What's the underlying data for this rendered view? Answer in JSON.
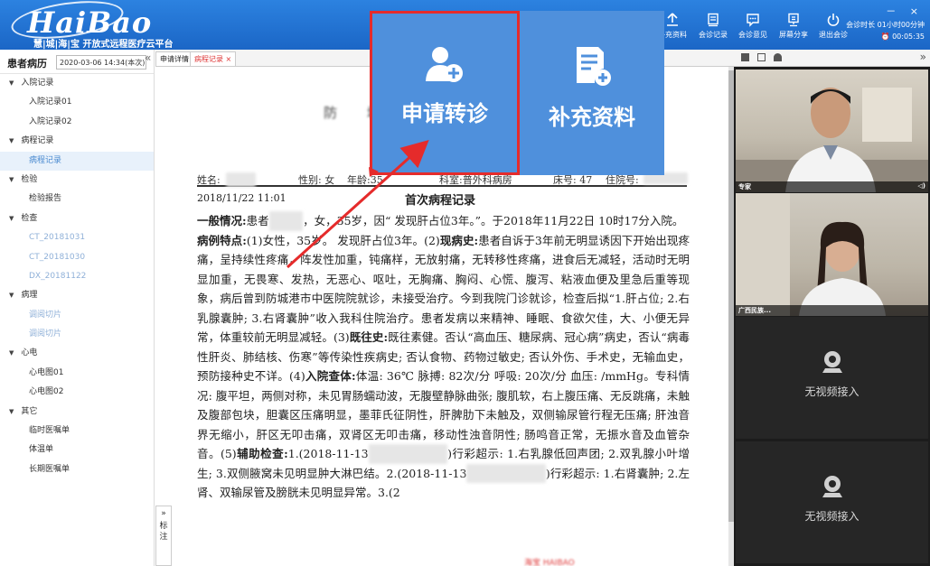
{
  "app": {
    "logo": "HaiBao",
    "tagline": "慧|城|海|宝 开放式远程医疗云平台",
    "window_controls": "－ ×"
  },
  "toolbar": {
    "buttons": [
      {
        "icon": "upload-icon",
        "label": "补充资料"
      },
      {
        "icon": "record-icon",
        "label": "会诊记录"
      },
      {
        "icon": "chat-icon",
        "label": "会诊意见"
      },
      {
        "icon": "screen-share-icon",
        "label": "屏幕分享"
      },
      {
        "icon": "power-icon",
        "label": "退出会诊"
      }
    ],
    "session_label": "会诊时长 01小时00分钟",
    "session_clock": "⏰ 00:05:35"
  },
  "sidebar": {
    "title": "患者病历",
    "date_select": "2020-03-06 14:34(本次) ▾",
    "collapse": "«",
    "groups": [
      {
        "label": "入院记录",
        "items": [
          {
            "label": "入院记录01"
          },
          {
            "label": "入院记录02"
          }
        ]
      },
      {
        "label": "病程记录",
        "items": [
          {
            "label": "病程记录",
            "active": true
          }
        ]
      },
      {
        "label": "检验",
        "items": [
          {
            "label": "检验报告"
          }
        ]
      },
      {
        "label": "检查",
        "items": [
          {
            "label": "CT_20181031",
            "dim": true
          },
          {
            "label": "CT_20181030",
            "dim": true
          },
          {
            "label": "DX_20181122",
            "dim": true
          }
        ]
      },
      {
        "label": "病理",
        "items": [
          {
            "label": "调阅切片",
            "dim": true
          },
          {
            "label": "调阅切片",
            "dim": true
          }
        ]
      },
      {
        "label": "心电",
        "items": [
          {
            "label": "心电图01"
          },
          {
            "label": "心电图02"
          }
        ]
      },
      {
        "label": "其它",
        "items": [
          {
            "label": "临时医嘱单"
          },
          {
            "label": "体温单"
          },
          {
            "label": "长期医嘱单"
          }
        ]
      }
    ]
  },
  "tabs": [
    {
      "label": "申请详情"
    },
    {
      "label": "病程记录 ×",
      "active": true
    }
  ],
  "document": {
    "hospital": "防 城",
    "patient_row": {
      "name_label": "姓名:",
      "gender": "性别: 女",
      "age": "年龄:35",
      "dept": "科室:普外科病房",
      "bed": "床号: 47",
      "admission_label": "住院号:"
    },
    "date": "2018/11/22 11:01",
    "title": "首次病程记录",
    "paragraphs": [
      [
        {
          "b": "一般情况:"
        },
        {
          "t": "患者"
        },
        {
          "blur": "某某某"
        },
        {
          "t": "，女，35岁，因“ 发现肝占位3年。”。于2018年11月22日 10时17分入院。"
        }
      ],
      [
        {
          "b": "病例特点:"
        },
        {
          "t": "(1)女性，35岁。 发现肝占位3年。(2)"
        },
        {
          "b": "现病史:"
        },
        {
          "t": "患者自诉于3年前无明显诱因下开始出现疼痛，呈持续性疼痛，阵发性加重，钝痛样，无放射痛，无转移性疼痛，进食后无减轻，活动时无明显加重，无畏寒、发热，无恶心、呕吐，无胸痛、胸闷、心慌、腹泻、粘液血便及里急后重等现象，病后曾到防城港市中医院院就诊，未接受治疗。今到我院门诊就诊，检查后拟“1.肝占位; 2.右乳腺囊肿; 3.右肾囊肿”收入我科住院治疗。患者发病以来精神、睡眠、食欲欠佳，大、小便无异常，体重较前无明显减轻。(3)"
        },
        {
          "b": "既往史:"
        },
        {
          "t": "既往素健。否认“高血压、糖尿病、冠心病”病史，否认“病毒性肝炎、肺结核、伤寒”等传染性疾病史; 否认食物、药物过敏史; 否认外伤、手术史，无输血史，预防接种史不详。(4)"
        },
        {
          "b": "入院查体:"
        },
        {
          "t": "体温: 36℃ 脉搏: 82次/分 呼吸: 20次/分 血压: /mmHg。专科情况: 腹平坦，两侧对称，未见胃肠蠕动波，无腹壁静脉曲张; 腹肌软，右上腹压痛、无反跳痛，未触及腹部包块，胆囊区压痛明显，墨菲氏征阴性，肝脾肋下未触及，双侧输尿管行程无压痛; 肝浊音界无缩小，肝区无叩击痛，双肾区无叩击痛，移动性浊音阴性; 肠鸣音正常，无振水音及血管杂音。(5)"
        },
        {
          "b": "辅助检查:"
        },
        {
          "t": "1.(2018-11-13"
        },
        {
          "blur": "防城港市中医院"
        },
        {
          "t": ")行彩超示: 1.右乳腺低回声团; 2.双乳腺小叶增生; 3.双侧腋窝未见明显肿大淋巴结。2.(2018-11-13"
        },
        {
          "blur": "防城港市中医院"
        },
        {
          "t": ")行彩超示: 1.右肾囊肿; 2.左肾、双输尿管及膀胱未见明显异常。3.(2"
        }
      ]
    ]
  },
  "annotation": {
    "collapse": "»",
    "label": "标注"
  },
  "video_panel": {
    "expand": "»",
    "tiles": [
      {
        "label": "专家",
        "icon": "mute-icon",
        "mute": "◁)"
      },
      {
        "label": "广西民族..."
      }
    ],
    "empty_tiles": [
      {
        "label": "无视频接入"
      },
      {
        "label": "无视频接入"
      }
    ]
  },
  "popup": {
    "buttons": [
      {
        "icon": "add-user-icon",
        "label": "申请转诊",
        "highlighted": true
      },
      {
        "icon": "add-document-icon",
        "label": "补充资料"
      }
    ],
    "highlight_color": "#e52b2b"
  },
  "colors": {
    "header": "#1b66c6",
    "popup": "#4f90dc",
    "highlight": "#e52b2b"
  }
}
